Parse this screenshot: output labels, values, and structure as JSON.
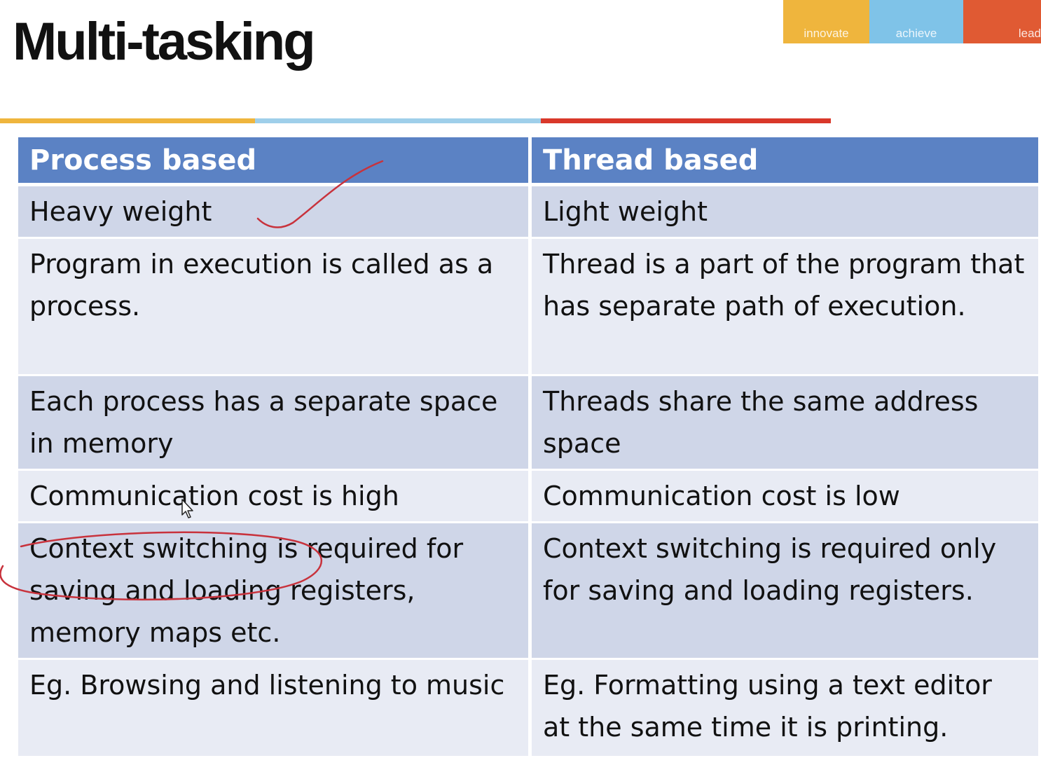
{
  "slide": {
    "title": "Multi-tasking",
    "logo": [
      "innovate",
      "achieve",
      "lead"
    ],
    "colors": {
      "header_bg": "#5b82c4",
      "row_dark": "#cfd6e8",
      "row_light": "#e8ebf4",
      "accent_orange": "#efb53d",
      "accent_blue": "#9fcfea",
      "accent_red": "#d9382a",
      "annotation_ink": "#c8323c"
    }
  },
  "table": {
    "headers": [
      "Process based",
      "Thread based"
    ],
    "rows": [
      [
        "Heavy weight",
        "Light weight"
      ],
      [
        "Program in execution is called as a process.",
        "Thread is a part of the program that has separate path of execution."
      ],
      [
        "Each process has a separate space in memory",
        "Threads share the same address space"
      ],
      [
        "Communication cost is high",
        "Communication cost is low"
      ],
      [
        "Context switching is required for saving and loading registers, memory maps etc.",
        "Context switching is required only for saving and loading registers."
      ],
      [
        "Eg. Browsing and listening to music",
        "Eg. Formatting using a text editor at the same time it is printing."
      ]
    ]
  },
  "annotations": {
    "tick_mark": "check-mark-icon",
    "ellipse": "hand-drawn-ellipse",
    "cursor": "mouse-pointer-icon"
  }
}
